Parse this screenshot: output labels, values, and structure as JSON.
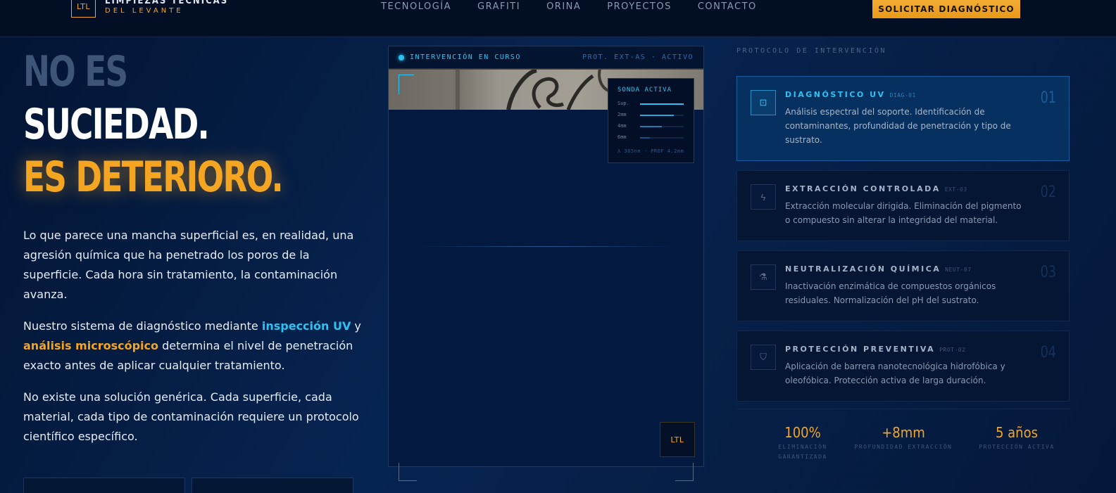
{
  "header": {
    "logo_text": "LTL",
    "brand_line1": "LIMPIEZAS TÉCNICAS",
    "brand_line2": "DEL LEVANTE",
    "nav": [
      "TECNOLOGÍA",
      "GRAFITI",
      "ORINA",
      "PROYECTOS",
      "CONTACTO"
    ],
    "cta_label": "SOLICITAR DIAGNÓSTICO"
  },
  "hero": {
    "line1": "NO ES",
    "line2": "SUCIEDAD.",
    "line3": "ES DETERIORO.",
    "para1": "Lo que parece una mancha superficial es, en realidad, una agresión química que ha penetrado los poros de la superficie. Cada hora sin tratamiento, la contaminación avanza.",
    "para2_pre": "Nuestro sistema de diagnóstico mediante ",
    "para2_uv": "inspección UV",
    "para2_mid": " y ",
    "para2_mic": "análisis microscópico",
    "para2_post": " determina el nivel de penetración exacto antes de aplicar cualquier tratamiento.",
    "para3": "No existe una solución genérica. Cada superficie, cada material, cada tipo de contaminación requiere un protocolo científico específico."
  },
  "panel": {
    "status": "INTERVENCIÓN EN CURSO",
    "protocol": "PROT. EXT-AS · ACTIVO",
    "badge": "LTL",
    "probe": {
      "title": "SONDA ACTIVA",
      "rows": [
        {
          "label": "Sup.",
          "level": 1.0
        },
        {
          "label": "2mm",
          "level": 0.78
        },
        {
          "label": "4mm",
          "level": 0.5
        },
        {
          "label": "6mm",
          "level": 0.22
        }
      ],
      "footer": "λ 365nm · PROF 4.2mm"
    }
  },
  "protocol": {
    "title": "PROTOCOLO DE INTERVENCIÓN",
    "cards": [
      {
        "title": "DIAGNÓSTICO UV",
        "code": "DIAG-01",
        "number": "01",
        "icon": "scan-icon",
        "glyph": "⊡",
        "desc": "Análisis espectral del soporte. Identificación de contaminantes, profundidad de penetración y tipo de sustrato."
      },
      {
        "title": "EXTRACCIÓN CONTROLADA",
        "code": "EXT-03",
        "number": "02",
        "icon": "bolt-icon",
        "glyph": "ϟ",
        "desc": "Extracción molecular dirigida. Eliminación del pigmento o compuesto sin alterar la integridad del material."
      },
      {
        "title": "NEUTRALIZACIÓN QUÍMICA",
        "code": "NEUT-07",
        "number": "03",
        "icon": "flask-icon",
        "glyph": "⚗",
        "desc": "Inactivación enzimática de compuestos orgánicos residuales. Normalización del pH del sustrato."
      },
      {
        "title": "PROTECCIÓN PREVENTIVA",
        "code": "PROT-02",
        "number": "04",
        "icon": "shield-icon",
        "glyph": "⛉",
        "desc": "Aplicación de barrera nanotecnológica hidrofóbica y oleofóbica. Protección activa de larga duración."
      }
    ]
  },
  "stats": [
    {
      "value": "100%",
      "label": "ELIMINACIÓN GARANTIZADA"
    },
    {
      "value": "+8mm",
      "label": "PROFUNDIDAD EXTRACCIÓN"
    },
    {
      "value": "5 años",
      "label": "PROTECCIÓN ACTIVA"
    }
  ],
  "colors": {
    "accent": "#f4a623",
    "cyan": "#2cc3f2",
    "background": "#061a3a"
  }
}
